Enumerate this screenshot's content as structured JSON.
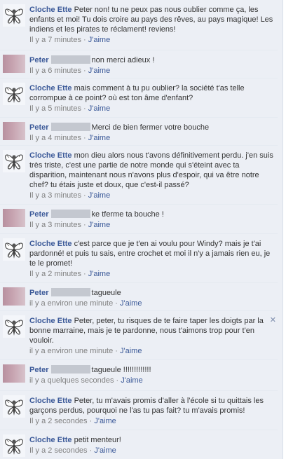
{
  "comments": [
    {
      "author": "Cloche Ette",
      "avatar": "fairy",
      "text": "Peter non! tu ne peux pas nous oublier comme ça, les enfants et moi! Tu dois croire au pays des rêves, au pays magique! Les indiens et les pirates te réclament! reviens!",
      "time": "Il y a 7 minutes",
      "like": "J'aime"
    },
    {
      "author": "Peter",
      "avatar": "peter",
      "text": "non merci adieux !",
      "time": "Il y a 6 minutes",
      "like": "J'aime"
    },
    {
      "author": "Cloche Ette",
      "avatar": "fairy",
      "text": "mais comment à tu pu oublier? la société t'as telle corrompue à ce point? où est ton âme d'enfant?",
      "time": "Il y a 5 minutes",
      "like": "J'aime"
    },
    {
      "author": "Peter",
      "avatar": "peter",
      "text": "Merci de bien fermer votre bouche",
      "time": "Il y a 4 minutes",
      "like": "J'aime"
    },
    {
      "author": "Cloche Ette",
      "avatar": "fairy",
      "text": "mon dieu alors nous t'avons définitivement perdu. j'en suis très triste, c'est une partie de notre monde qui s'éteint avec ta disparition, maintenant nous n'avons plus d'espoir, qui va être notre chef? tu étais juste et doux, que c'est-il passé?",
      "time": "Il y a 3 minutes",
      "like": "J'aime"
    },
    {
      "author": "Peter",
      "avatar": "peter",
      "text": "ke tferme ta bouche !",
      "time": "Il y a 3 minutes",
      "like": "J'aime"
    },
    {
      "author": "Cloche Ette",
      "avatar": "fairy",
      "text": "c'est parce que je t'en ai voulu pour Windy? mais je t'ai pardonné! et puis tu sais, entre crochet et moi il n'y a jamais rien eu, je te le promet!",
      "time": "Il y a 2 minutes",
      "like": "J'aime"
    },
    {
      "author": "Peter",
      "avatar": "peter",
      "text": "tagueule",
      "time": "il y a environ une minute",
      "like": "J'aime"
    },
    {
      "author": "Cloche Ette",
      "avatar": "fairy",
      "text": "Peter, peter, tu risques de te faire taper les doigts par la bonne marraine, mais je te pardonne, nous t'aimons trop pour t'en vouloir.",
      "time": "il y a environ une minute",
      "like": "J'aime",
      "close": "✕"
    },
    {
      "author": "Peter",
      "avatar": "peter",
      "text": "tagueule !!!!!!!!!!!!!",
      "time": "il y a quelques secondes",
      "like": "J'aime"
    },
    {
      "author": "Cloche Ette",
      "avatar": "fairy",
      "text": "Peter, tu m'avais promis d'aller à l'école si tu quittais les garçons perdus, pourquoi ne l'as tu pas fait? tu m'avais promis!",
      "time": "Il y a 2 secondes",
      "like": "J'aime"
    },
    {
      "author": "Cloche Ette",
      "avatar": "fairy",
      "text": "petit menteur!",
      "time": "Il y a 2 secondes",
      "like": "J'aime"
    }
  ],
  "colors": {
    "author": "#3b5998",
    "feed_bg": "#eceff5",
    "meta": "#808080"
  }
}
